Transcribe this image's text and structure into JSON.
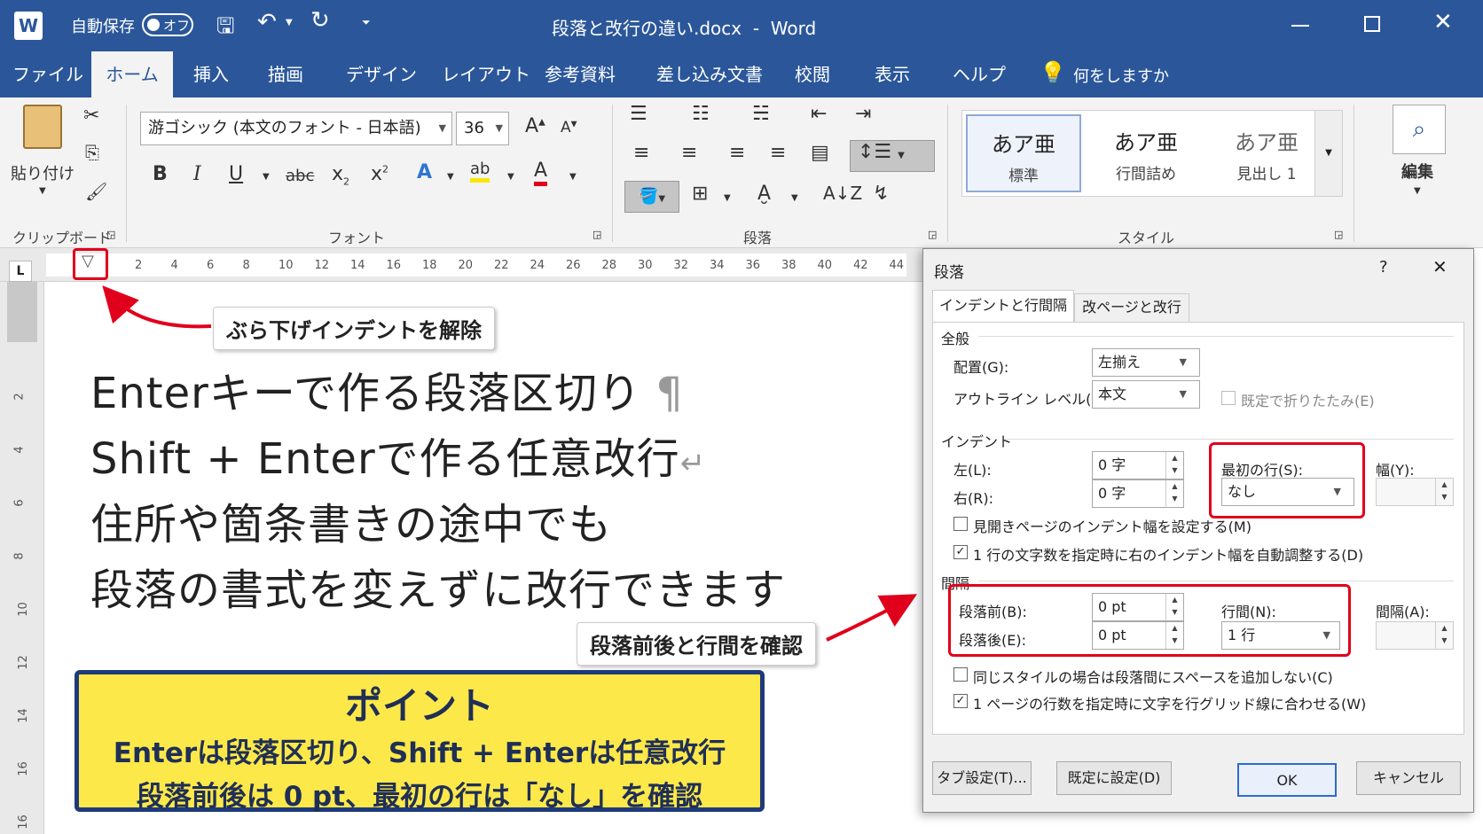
{
  "titlebar": {
    "autosave_label": "自動保存",
    "autosave_state": "オフ",
    "doc_title": "段落と改行の違い.docx  -  Word"
  },
  "tabs": [
    "ファイル",
    "ホーム",
    "挿入",
    "描画",
    "デザイン",
    "レイアウト",
    "参考資料",
    "差し込み文書",
    "校閲",
    "表示",
    "ヘルプ"
  ],
  "tellme": "何をしますか",
  "ribbon": {
    "paste_label": "貼り付け",
    "clipboard_label": "クリップボード",
    "font_name": "游ゴシック (本文のフォント - 日本語)",
    "font_size": "36",
    "font_label": "フォント",
    "paragraph_label": "段落",
    "styles_label": "スタイル",
    "styles": [
      {
        "preview": "あア亜",
        "name": "標準"
      },
      {
        "preview": "あア亜",
        "name": "行間詰め"
      },
      {
        "preview": "あア亜",
        "name": "見出し 1"
      }
    ],
    "edit_label": "編集"
  },
  "ruler": {
    "corner": "L",
    "ticks": [
      "2",
      "4",
      "6",
      "8",
      "10",
      "12",
      "14",
      "16",
      "18",
      "20",
      "22",
      "24",
      "26",
      "28",
      "30",
      "32",
      "34",
      "36",
      "38",
      "40",
      "42",
      "44"
    ],
    "vticks": [
      "2",
      "4",
      "6",
      "8",
      "10",
      "12",
      "14",
      "16",
      "16"
    ]
  },
  "document": {
    "lines": [
      "Enterキーで作る段落区切り",
      "Shift + Enterで作る任意改行",
      "住所や箇条書きの途中でも",
      "段落の書式を変えずに改行できます"
    ],
    "pilcrow": "¶",
    "linebreak": "↵"
  },
  "callouts": {
    "hanging": "ぶら下げインデントを解除",
    "spacing": "段落前後と行間を確認"
  },
  "point": {
    "title": "ポイント",
    "line1": "Enterは段落区切り、Shift + Enterは任意改行",
    "line2": "段落前後は 0 pt、最初の行は「なし」を確認"
  },
  "dialog": {
    "title": "段落",
    "help": "?",
    "close": "✕",
    "tab1": "インデントと行間隔",
    "tab2": "改ページと改行",
    "general": "全般",
    "alignment_label": "配置(G):",
    "alignment_value": "左揃え",
    "outline_label": "アウトライン レベル(O):",
    "outline_value": "本文",
    "collapse_label": "既定で折りたたみ(E)",
    "indent": "インデント",
    "left_label": "左(L):",
    "left_value": "0 字",
    "right_label": "右(R):",
    "right_value": "0 字",
    "firstline_label": "最初の行(S):",
    "firstline_value": "なし",
    "width_label": "幅(Y):",
    "mirror_label": "見開きページのインデント幅を設定する(M)",
    "autoadjust_label": "1 行の文字数を指定時に右のインデント幅を自動調整する(D)",
    "spacing": "間隔",
    "before_label": "段落前(B):",
    "before_value": "0 pt",
    "after_label": "段落後(E):",
    "after_value": "0 pt",
    "linespacing_label": "行間(N):",
    "linespacing_value": "1 行",
    "interval_label": "間隔(A):",
    "nosame_label": "同じスタイルの場合は段落間にスペースを追加しない(C)",
    "grid_label": "1 ページの行数を指定時に文字を行グリッド線に合わせる(W)",
    "tabs_btn": "タブ設定(T)...",
    "default_btn": "既定に設定(D)",
    "ok_btn": "OK",
    "cancel_btn": "キャンセル"
  },
  "colors": {
    "word_blue": "#2b579a",
    "red": "#e0001b",
    "point_bg": "#fde84a",
    "point_border": "#1f3a7a"
  }
}
